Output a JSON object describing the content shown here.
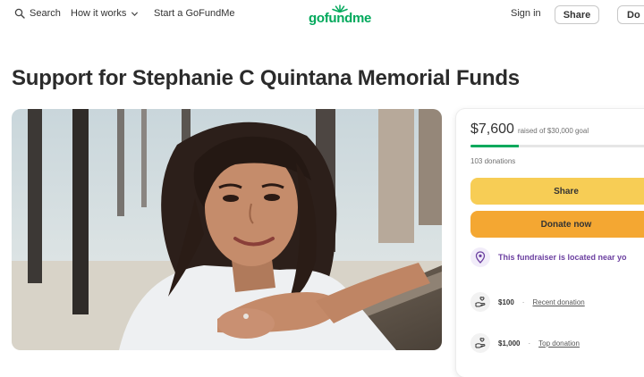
{
  "header": {
    "search_label": "Search",
    "how_label": "How it works",
    "start_label": "Start a GoFundMe",
    "logo_text": "gofundme",
    "signin_label": "Sign in",
    "share_label": "Share",
    "donate_label": "Do"
  },
  "campaign": {
    "title": "Support for Stephanie C Quintana Memorial Funds"
  },
  "card": {
    "raised": "$7,600",
    "goal_text": "raised of $30,000 goal",
    "progress_fraction": 0.253,
    "donations_text": "103 donations",
    "share_label": "Share",
    "donate_label": "Donate now",
    "location_text": "This fundraiser is located near yo",
    "top_donations": [
      {
        "amount": "$100",
        "label": "Recent donation"
      },
      {
        "amount": "$1,000",
        "label": "Top donation"
      }
    ]
  },
  "colors": {
    "brand_green": "#02a95c",
    "share_yellow": "#f7cd55",
    "donate_orange": "#f4a732",
    "location_purple": "#6b3fa0"
  },
  "icons": [
    "search-icon",
    "chevron-down-icon",
    "location-icon",
    "donation-hand-icon"
  ]
}
